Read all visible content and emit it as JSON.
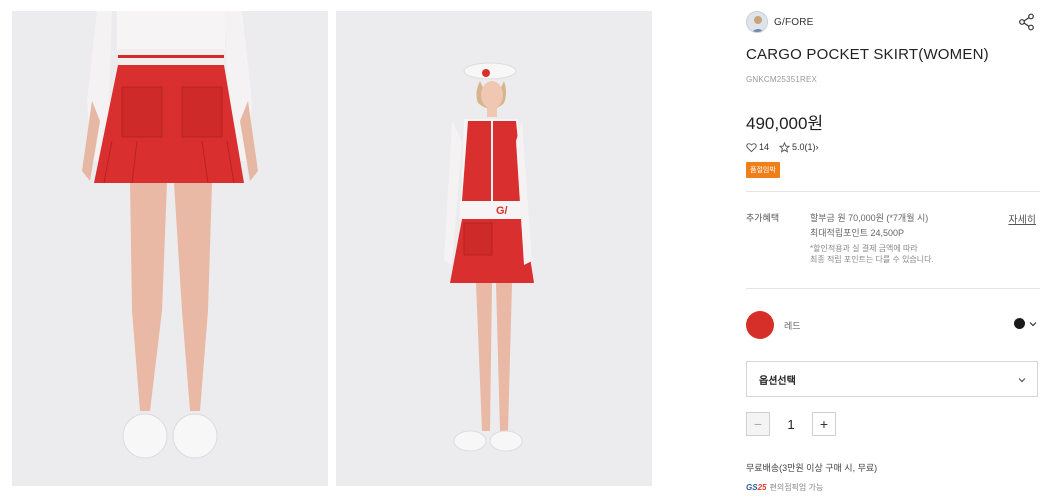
{
  "brand": {
    "name": "G/FORE",
    "logo_icon": "brand-avatar"
  },
  "product": {
    "title": "CARGO POCKET SKIRT(WOMEN)",
    "code": "GNKCM25351REX",
    "price": "490,000원"
  },
  "meta": {
    "likes": "14",
    "rating": "5.0",
    "reviews": "(1)",
    "rating_arrow": "›"
  },
  "badge": {
    "label": "품절임박",
    "color": "#f07f1a"
  },
  "benefits": {
    "label": "추가혜택",
    "line1": "할부금 원 70,000원 (*7개월 시)",
    "line2": "최대적립포인트 24,500P",
    "note1": "*할인적용과 실 결제 금액에 따라",
    "note2": "최종 적립 포인트는 다를 수 있습니다.",
    "detail_link": "자세히"
  },
  "color": {
    "name": "레드",
    "swatch": "#d62f2a",
    "selected_dot": "#1a1a1a"
  },
  "option": {
    "placeholder": "옵션선택"
  },
  "quantity": {
    "minus": "−",
    "value": "1",
    "plus": "+"
  },
  "shipping": {
    "text": "무료배송(3만원 이상 구매 시, 무료)"
  },
  "store": {
    "logo_text": "GS",
    "logo_num": "25",
    "text": "편의점픽업 가능"
  },
  "images": {
    "left": {
      "subject": "skirt-front-view"
    },
    "right": {
      "subject": "model-full-outfit"
    }
  }
}
